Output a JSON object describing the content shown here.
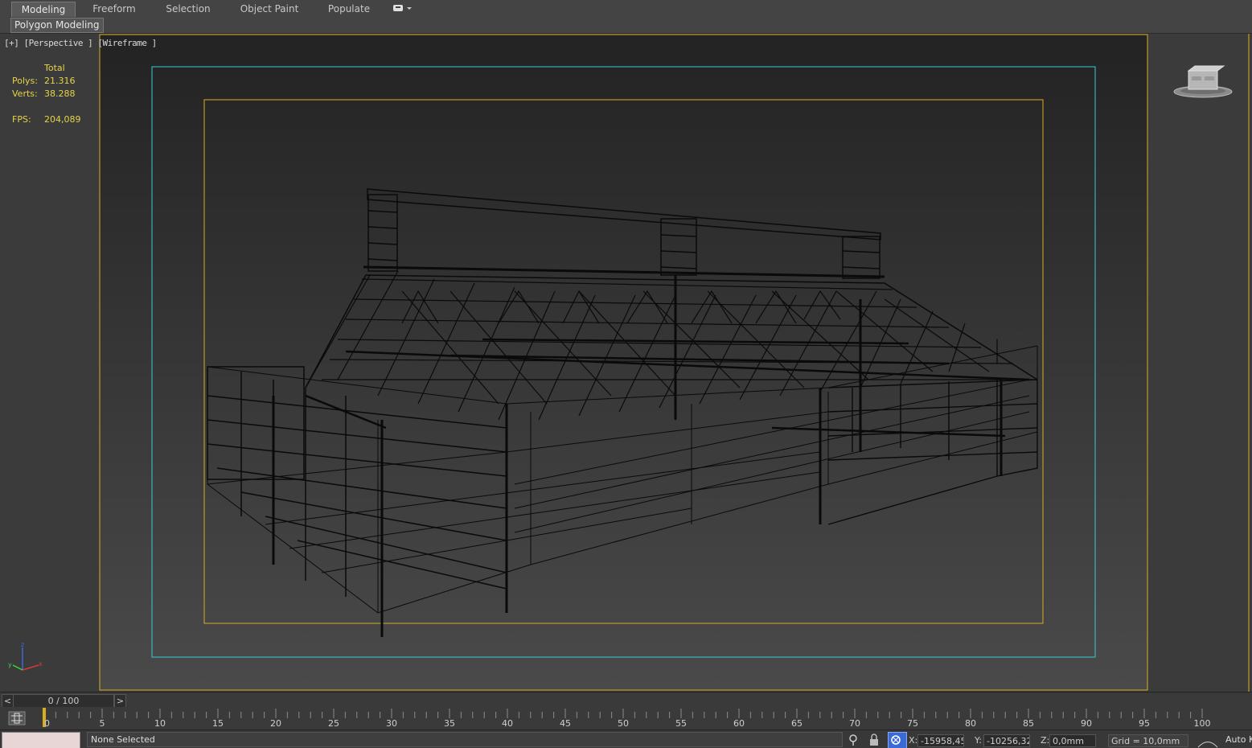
{
  "ribbon": {
    "tabs": [
      {
        "label": "Modeling",
        "active": true
      },
      {
        "label": "Freeform"
      },
      {
        "label": "Selection"
      },
      {
        "label": "Object Paint"
      },
      {
        "label": "Populate"
      }
    ],
    "extra_icon": "ribbon-options-icon"
  },
  "subbar": {
    "polygon_modeling": "Polygon Modeling"
  },
  "viewport": {
    "label": "[+] [Perspective ] [Wireframe ]",
    "stats": {
      "total_label": "Total",
      "polys_label": "Polys:",
      "polys_value": "21.316",
      "verts_label": "Verts:",
      "verts_value": "38.288",
      "fps_label": "FPS:",
      "fps_value": "204,089"
    },
    "colors": {
      "safe_frame_outer": "#d4b021",
      "safe_frame_action": "#3cc9d6",
      "safe_frame_title": "#d4b021"
    }
  },
  "timeline": {
    "prev_label": "<",
    "next_label": ">",
    "frame_label": "0 / 100",
    "ticks": [
      "0",
      "5",
      "10",
      "15",
      "20",
      "25",
      "30",
      "35",
      "40",
      "45",
      "50",
      "55",
      "60",
      "65",
      "70",
      "75",
      "80",
      "85",
      "90",
      "95",
      "100"
    ]
  },
  "status": {
    "selection": "None Selected",
    "x_label": "X:",
    "x_value": "-15958,45",
    "y_label": "Y:",
    "y_value": "-10256,32",
    "z_label": "Z:",
    "z_value": "0,0mm",
    "grid": "Grid = 10,0mm",
    "auto_key": "Auto K"
  }
}
